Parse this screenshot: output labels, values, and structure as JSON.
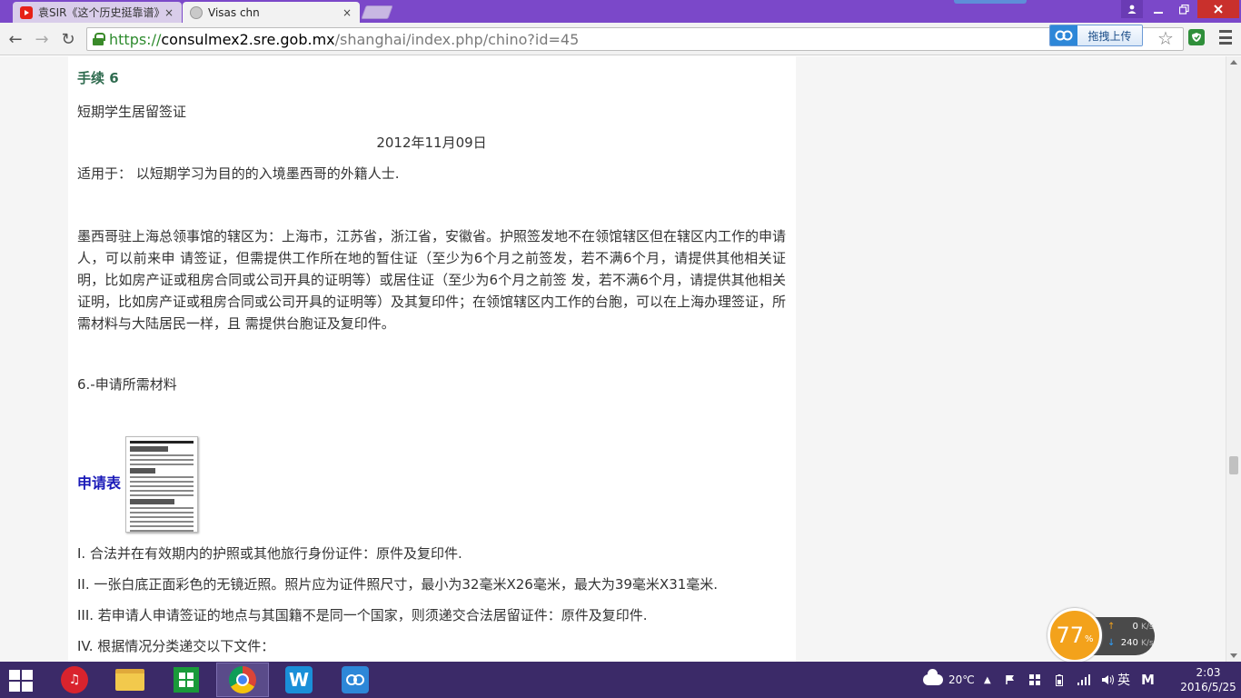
{
  "tabs": [
    {
      "title": "袁SIR《这个历史挺靠谱》",
      "close": "×"
    },
    {
      "title": "Visas chn",
      "close": "×"
    }
  ],
  "toolbar": {
    "back": "←",
    "forward": "→",
    "reload": "↻",
    "url_scheme": "https://",
    "url_host": "consulmex2.sre.gob.mx",
    "url_path": "/shanghai/index.php/chino?id=45",
    "upload_label": "拖拽上传",
    "star": "☆"
  },
  "page": {
    "step_title": "手续 6",
    "visa_name": "短期学生居留签证",
    "date": "2012年11月09日",
    "applies_to": "适用于： 以短期学习为目的的入境墨西哥的外籍人士.",
    "jurisdiction": "墨西哥驻上海总领事馆的辖区为：上海市，江苏省，浙江省，安徽省。护照签发地不在领馆辖区但在辖区内工作的申请人，可以前来申 请签证，但需提供工作所在地的暂住证（至少为6个月之前签发，若不满6个月，请提供其他相关证明，比如房产证或租房合同或公司开具的证明等）或居住证（至少为6个月之前签 发，若不满6个月，请提供其他相关证明，比如房产证或租房合同或公司开具的证明等）及其复印件；在领馆辖区内工作的台胞，可以在上海办理签证，所需材料与大陆居民一样，且 需提供台胞证及复印件。",
    "section_head": "6.-申请所需材料",
    "form_link": "申请表",
    "requirements": [
      "I. 合法并在有效期内的护照或其他旅行身份证件：原件及复印件.",
      "II. 一张白底正面彩色的无镜近照。照片应为证件照尺寸，最小为32毫米X26毫米，最大为39毫米X31毫米.",
      "III. 若申请人申请签证的地点与其国籍不是同一个国家，则须递交合法居留证件：原件及复印件.",
      "IV. 根据情况分类递交以下文件："
    ]
  },
  "widget": {
    "percent": "77",
    "percent_symbol": "%",
    "up_speed": "0",
    "down_speed": "240",
    "unit": "K/s"
  },
  "tray": {
    "temperature": "20℃",
    "up_arrow": "▲",
    "ime": "英",
    "m_icon": "M",
    "time": "2:03",
    "date": "2016/5/25"
  },
  "colors": {
    "titlebar": "#7b48c9",
    "taskbar": "#3b2a68",
    "step_title": "#2f6b4f",
    "form_link": "#1a1ab8",
    "widget_orange": "#f3a21b"
  }
}
